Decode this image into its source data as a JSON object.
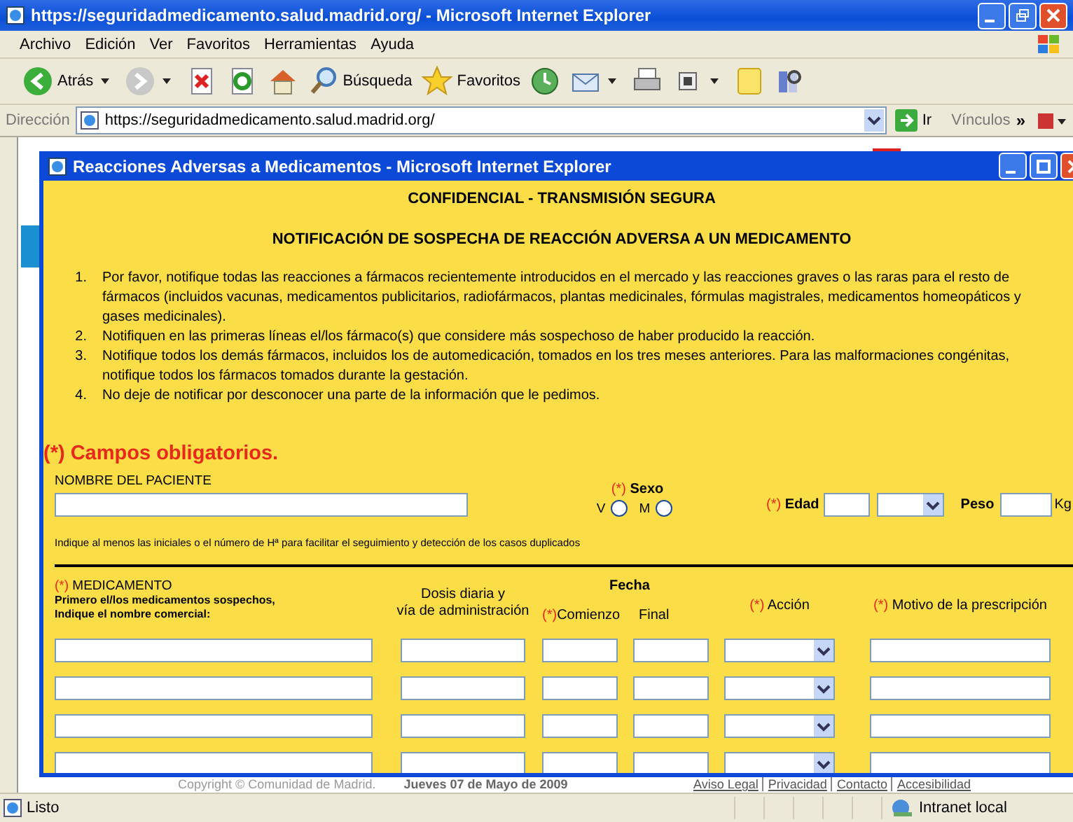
{
  "browser": {
    "title": "https://seguridadmedicamento.salud.madrid.org/ - Microsoft Internet Explorer",
    "menu": [
      "Archivo",
      "Edición",
      "Ver",
      "Favoritos",
      "Herramientas",
      "Ayuda"
    ],
    "toolbar": [
      {
        "kind": "back",
        "label": "Atrás",
        "dropdown": true
      },
      {
        "kind": "forward",
        "dropdown": true
      },
      {
        "kind": "stop",
        "dropdown": false
      },
      {
        "kind": "refresh",
        "dropdown": false
      },
      {
        "kind": "home",
        "dropdown": false
      },
      {
        "kind": "search",
        "label": "Búsqueda",
        "dropdown": false
      },
      {
        "kind": "favorites",
        "label": "Favoritos",
        "dropdown": false
      },
      {
        "kind": "history",
        "dropdown": false
      },
      {
        "kind": "mail",
        "dropdown": true
      },
      {
        "kind": "print",
        "dropdown": false
      },
      {
        "kind": "edit",
        "dropdown": true
      },
      {
        "kind": "note",
        "dropdown": false
      },
      {
        "kind": "research",
        "dropdown": false
      }
    ],
    "address": {
      "label": "Dirección",
      "value": "https://seguridadmedicamento.salud.madrid.org/",
      "go": "Ir",
      "links": "Vínculos",
      "more": "»"
    }
  },
  "page": {
    "copyright": "Copyright © Comunidad de Madrid.",
    "date": "Jueves 07 de Mayo de 2009",
    "links": [
      "Aviso Legal",
      "Privacidad",
      "Contacto",
      "Accesibilidad"
    ]
  },
  "popup": {
    "title": "Reacciones Adversas a Medicamentos - Microsoft Internet Explorer",
    "banner": "CONFIDENCIAL - TRANSMISIÓN SEGURA",
    "heading": "NOTIFICACIÓN DE SOSPECHA DE REACCIÓN ADVERSA A UN MEDICAMENTO",
    "instructions": [
      {
        "number": "1.",
        "text": "Por favor, notifique todas las reacciones a fármacos recientemente introducidos en el mercado y las reacciones graves o las raras para el resto de fármacos (incluidos vacunas, medicamentos publicitarios, radiofármacos, plantas medicinales, fórmulas magistrales, medicamentos homeopáticos y gases medicinales)."
      },
      {
        "number": "2.",
        "text": "Notifiquen en las primeras líneas el/los fármaco(s) que considere más sospechoso de haber producido la reacción."
      },
      {
        "number": "3.",
        "text": "Notifique todos los demás fármacos, incluidos los de automedicación, tomados en los tres meses anteriores. Para las malformaciones congénitas, notifique todos los fármacos tomados durante la gestación."
      },
      {
        "number": "4.",
        "text": "No deje de notificar por desconocer una parte de la información que le pedimos."
      }
    ],
    "required_note": "(*) Campos obligatorios.",
    "patient": {
      "name_label": "NOMBRE DEL PACIENTE",
      "sex": {
        "mark": "(*)",
        "label": "Sexo",
        "options": [
          {
            "label": "V",
            "selected": false
          },
          {
            "label": "M",
            "selected": false
          }
        ]
      },
      "age": {
        "mark": "(*)",
        "label": "Edad"
      },
      "weight": {
        "label": "Peso",
        "unit": "Kg"
      },
      "note": "Indique al menos las iniciales o el número de Hª para facilitar el seguimiento y detección de los casos duplicados"
    },
    "medication": {
      "drug": {
        "mark": "(*)",
        "label": "MEDICAMENTO",
        "hint": [
          "Primero el/los medicamentos sospechos,",
          "Indique el nombre comercial:"
        ]
      },
      "dose": [
        "Dosis diaria y",
        "vía de administración"
      ],
      "date": {
        "label": "Fecha",
        "start": {
          "mark": "(*)",
          "label": "Comienzo"
        },
        "end": {
          "label": "Final"
        }
      },
      "action": {
        "mark": "(*)",
        "label": "Acción"
      },
      "reason": {
        "mark": "(*)",
        "label": "Motivo de la prescripción"
      },
      "rows": [
        {
          "fields": [
            {
              "kind": "text"
            },
            {
              "kind": "text"
            },
            {
              "kind": "text"
            },
            {
              "kind": "text"
            },
            {
              "kind": "select"
            },
            {
              "kind": "text"
            }
          ]
        },
        {
          "fields": [
            {
              "kind": "text"
            },
            {
              "kind": "text"
            },
            {
              "kind": "text"
            },
            {
              "kind": "text"
            },
            {
              "kind": "select"
            },
            {
              "kind": "text"
            }
          ]
        },
        {
          "fields": [
            {
              "kind": "text"
            },
            {
              "kind": "text"
            },
            {
              "kind": "text"
            },
            {
              "kind": "text"
            },
            {
              "kind": "select"
            },
            {
              "kind": "text"
            }
          ]
        },
        {
          "fields": [
            {
              "kind": "text"
            },
            {
              "kind": "text"
            },
            {
              "kind": "text"
            },
            {
              "kind": "text"
            },
            {
              "kind": "select"
            },
            {
              "kind": "text"
            }
          ]
        }
      ]
    }
  },
  "status_bar": {
    "text": "Listo",
    "zone": "Intranet local"
  }
}
